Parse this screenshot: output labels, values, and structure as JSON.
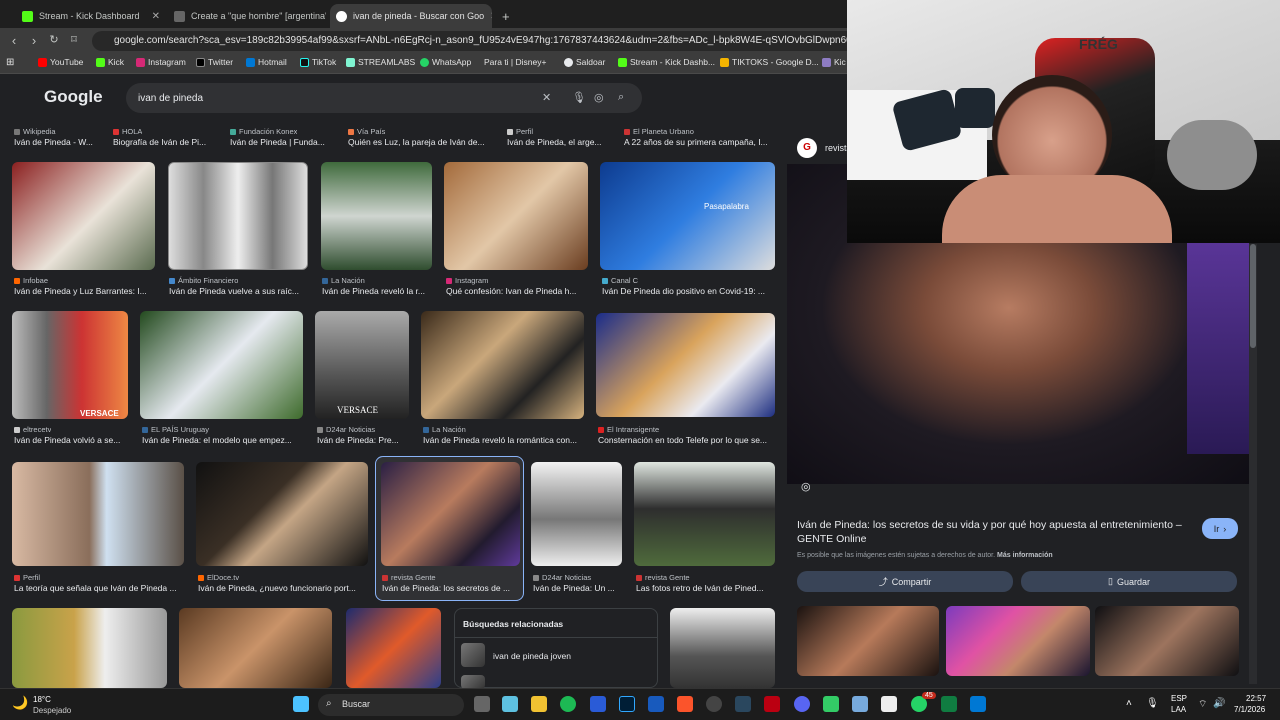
{
  "tabs": [
    {
      "label": "Stream - Kick Dashboard",
      "active": false
    },
    {
      "label": "Create a \"que hombre\" [argentina's v",
      "active": false
    },
    {
      "label": "ivan de pineda - Buscar con Goo",
      "active": true
    }
  ],
  "new_tab": "+",
  "url": "google.com/search?sca_esv=189c82b39954af99&sxsrf=ANbL-n6EgRcj-n_ason9_fU95z4vE947hg:1767837443624&udm=2&fbs=ADc_l-bpk8W4E-qSVlOvbGlDwpn60DzFdcvPnuv",
  "bookmarks": [
    "YouTube",
    "Kick",
    "Instagram",
    "Twitter",
    "Hotmail",
    "TikTok",
    "STREAMLABS",
    "WhatsApp",
    "Para ti | Disney+",
    "Saldoar",
    "Stream - Kick Dashb...",
    "TIKTOKS - Google D...",
    "Kic"
  ],
  "google": {
    "logo": "Google",
    "query": "ivan de pineda"
  },
  "top_results": [
    {
      "source": "Wikipedia",
      "title": "Iván de Pineda - W..."
    },
    {
      "source": "HOLA",
      "title": "Biografía de Iván de Pi..."
    },
    {
      "source": "Fundación Konex",
      "title": "Iván de Pineda | Funda..."
    },
    {
      "source": "Vía País",
      "title": "Quién es Luz, la pareja de Iván de..."
    },
    {
      "source": "Perfil",
      "title": "Iván de Pineda, el arge..."
    },
    {
      "source": "El Planeta Urbano",
      "title": "A 22 años de su primera campaña, I..."
    }
  ],
  "row1": [
    {
      "source": "Infobae",
      "title": "Iván de Pineda y Luz Barrantes: I..."
    },
    {
      "source": "Ámbito Financiero",
      "title": "Iván de Pineda vuelve a sus raíc..."
    },
    {
      "source": "La Nación",
      "title": "Iván de Pineda reveló la r..."
    },
    {
      "source": "Instagram",
      "title": "Qué confesión: Ivan de Pineda h..."
    },
    {
      "source": "Canal C",
      "title": "Iván De Pineda dio positivo en Covid-19: ..."
    }
  ],
  "row2": [
    {
      "source": "eltrecetv",
      "title": "Iván de Pineda volvió a se..."
    },
    {
      "source": "EL PAÍS Uruguay",
      "title": "Iván de Pineda: el modelo que empez..."
    },
    {
      "source": "D24ar Noticias",
      "title": "Iván de Pineda: Pre..."
    },
    {
      "source": "La Nación",
      "title": "Iván de Pineda reveló la romántica con..."
    },
    {
      "source": "El Intransigente",
      "title": "Consternación en todo Telefe por lo que se..."
    }
  ],
  "row3": [
    {
      "source": "Perfil",
      "title": "La teoría que señala que Iván de Pineda ..."
    },
    {
      "source": "ElDoce.tv",
      "title": "Iván de Pineda, ¿nuevo funcionario port..."
    },
    {
      "source": "revista Gente",
      "title": "Iván de Pineda: los secretos de ..."
    },
    {
      "source": "D24ar Noticias",
      "title": "Iván de Pineda: Un ..."
    },
    {
      "source": "revista Gente",
      "title": "Las fotos retro de Iván de Pined..."
    }
  ],
  "image_overlay_text": {
    "versace1": "VERSACE",
    "versace2": "VERSACE",
    "passapalabra": "Pasapalabra"
  },
  "related": {
    "heading": "Búsquedas relacionadas",
    "items": [
      "ivan de pineda joven"
    ]
  },
  "panel": {
    "source": "revista",
    "title": "Iván de Pineda: los secretos de su vida y por qué hoy apuesta al entretenimiento – GENTE Online",
    "visit": "Ir",
    "copyright": "Es posible que las imágenes estén sujetas a derechos de autor.",
    "more_info": "Más información",
    "share": "Compartir",
    "save": "Guardar"
  },
  "cam_text": "FRÉG",
  "taskbar": {
    "weather_temp": "18°C",
    "weather_desc": "Despejado",
    "search": "Buscar",
    "lang1": "ESP",
    "lang2": "LAA",
    "time": "22:57",
    "date": "7/1/2026",
    "badge": "45"
  }
}
